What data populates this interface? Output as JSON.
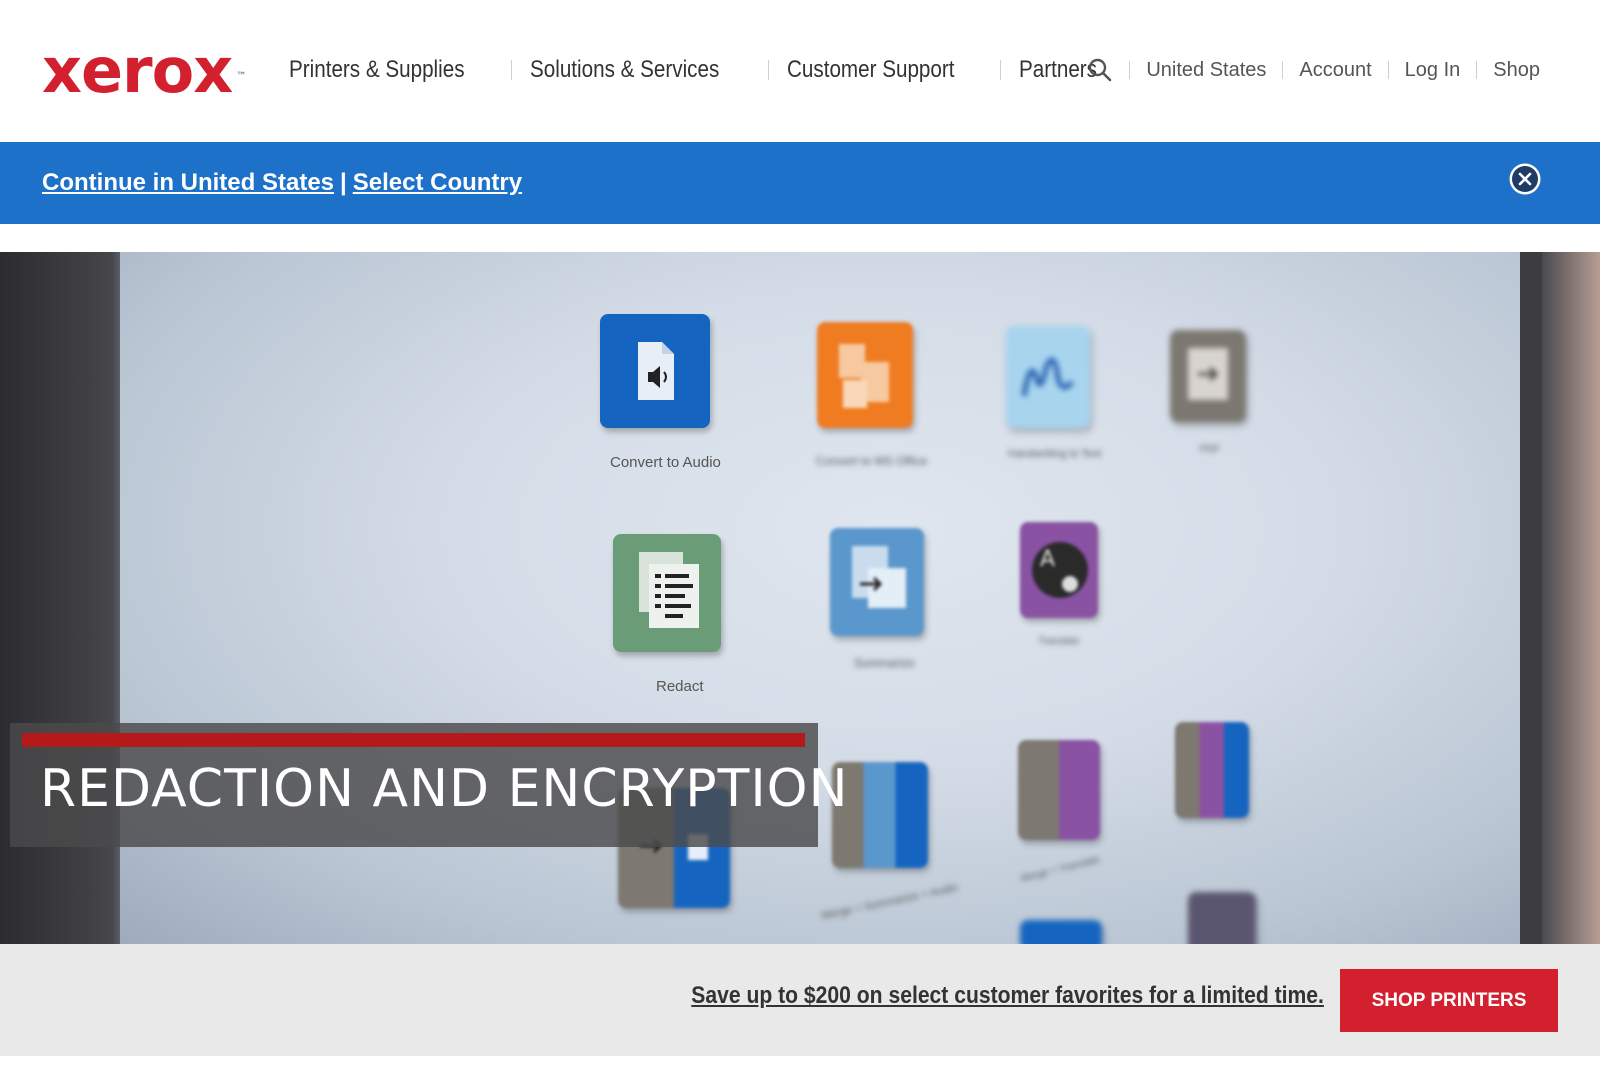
{
  "header": {
    "logo_text": "xerox",
    "logo_tm": "™",
    "brand_color": "#d3202f",
    "main_nav": [
      "Printers & Supplies",
      "Solutions & Services",
      "Customer Support",
      "Partners"
    ],
    "utility_nav": [
      "United States",
      "Account",
      "Log In",
      "Shop"
    ],
    "search_icon": "search-icon"
  },
  "country_banner": {
    "continue_label": "Continue in United States",
    "separator": "|",
    "select_label": "Select Country",
    "close_icon": "close-circle-icon",
    "background": "#1d71c8"
  },
  "hero": {
    "caption": "REDACTION AND ENCRYPTION",
    "apps": [
      {
        "label": "Convert to Audio",
        "icon": "audio-file-icon",
        "color": "#1565c0"
      },
      {
        "label": "Convert to MS Office",
        "icon": "office-convert-icon",
        "color": "#f07c22"
      },
      {
        "label": "Handwriting to Text",
        "icon": "handwriting-icon",
        "color": "#a8d4ee"
      },
      {
        "label": "PDF",
        "icon": "pdf-icon",
        "color": "#7c7770"
      },
      {
        "label": "Redact",
        "icon": "redact-document-icon",
        "color": "#6b9c78"
      },
      {
        "label": "Summarize",
        "icon": "summarize-icon",
        "color": "#5a97cc"
      },
      {
        "label": "Translate",
        "icon": "translate-icon",
        "color": "#8a52a3"
      },
      {
        "label": "Merge + Summarize + Audio",
        "icon": "merge-icon",
        "color": "#2a6fc0"
      },
      {
        "label": "Merge + Translate",
        "icon": "merge-translate-icon",
        "color": "#8a52a3"
      }
    ]
  },
  "promo": {
    "text": "Save up to $200 on select customer favorites for a limited time.",
    "button_label": "SHOP PRINTERS"
  }
}
